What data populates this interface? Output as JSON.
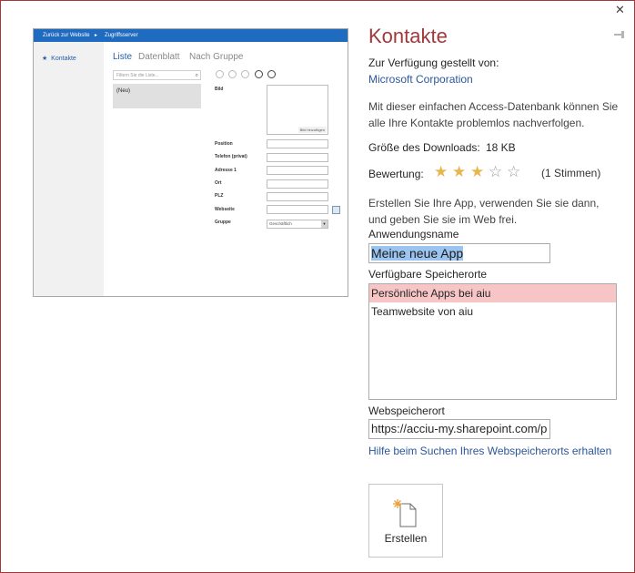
{
  "window": {
    "close_glyph": "✕",
    "pin_icon": "pin-icon"
  },
  "preview": {
    "topbar": {
      "back": "Zurück zur Website",
      "arrow": "►",
      "access": "Zugriffsserver"
    },
    "sidebar_item": "Kontakte",
    "tabs": [
      "Liste",
      "Datenblatt",
      "Nach Gruppe"
    ],
    "search_placeholder": "Filtern Sie die Liste...",
    "new_item": "(Neu)",
    "fields": [
      "Bild",
      "Position",
      "Telefon (privat)",
      "Adresse 1",
      "Ort",
      "PLZ",
      "Webseite",
      "Gruppe"
    ],
    "picture_button": "Bild hinzufügen",
    "group_value": "Geschäftlich"
  },
  "title": "Kontakte",
  "provided_by_label": "Zur Verfügung gestellt von:",
  "provider": "Microsoft Corporation",
  "description": "Mit dieser einfachen Access-Datenbank können Sie alle Ihre Kontakte problemlos nachverfolgen.",
  "download_size_label": "Größe des Downloads:",
  "download_size": "18 KB",
  "rating_label": "Bewertung:",
  "rating": {
    "value": 3,
    "max": 5,
    "votes_text": "(1 Stimmen)",
    "star_color": "#e7b64f"
  },
  "create_hint": "Erstellen Sie Ihre App, verwenden Sie sie dann, und geben Sie sie im Web frei.",
  "app_name_label": "Anwendungsname",
  "app_name_value": "Meine neue App",
  "locations_label": "Verfügbare Speicherorte",
  "locations": [
    "Persönliche Apps bei aiu",
    "Teamwebsite von aiu"
  ],
  "selected_location": 0,
  "web_location_label": "Webspeicherort",
  "web_location_value": "https://acciu-my.sharepoint.com/p",
  "help_link": "Hilfe beim Suchen Ihres Webspeicherorts erhalten",
  "create_button_label": "Erstellen",
  "accent_color": "#a4373a"
}
